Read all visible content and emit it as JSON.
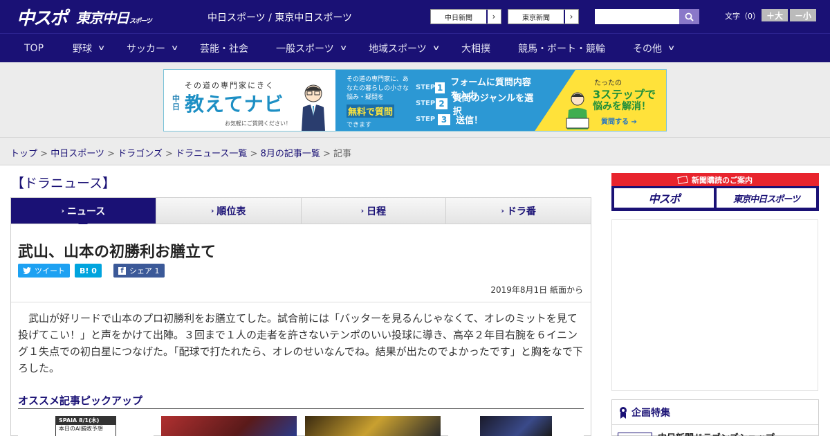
{
  "header": {
    "logo_chuspo": "中スポ",
    "logo_tokyo": "東京中日",
    "logo_tokyo_small": "スポーツ",
    "site_names": "中日スポーツ / 東京中日スポーツ",
    "link_chunichi": "中日新聞",
    "link_tokyo": "東京新聞",
    "font_label": "文字（0）",
    "font_bigger": "＋大",
    "font_smaller": "－小"
  },
  "nav": {
    "items": [
      {
        "label": "TOP"
      },
      {
        "label": "野球"
      },
      {
        "label": "サッカー"
      },
      {
        "label": "芸能・社会"
      },
      {
        "label": "一般スポーツ"
      },
      {
        "label": "地域スポーツ"
      },
      {
        "label": "大相撲"
      },
      {
        "label": "競馬・ボート・競輪"
      },
      {
        "label": "その他"
      }
    ]
  },
  "banner": {
    "tagline": "その道の専門家にきく",
    "brand_prefix": "中日",
    "brand": "教えてナビ",
    "note": "お気軽にご質問ください！",
    "question": "その道の専門家に、あなたの暮らしの小さな悩み・疑問を",
    "free": "無料で質問",
    "can": "できます",
    "step_word": "STEP",
    "steps": [
      "フォームに質問内容を入力",
      "質問のジャンルを選択",
      "送信！"
    ],
    "right_small": "たったの",
    "right_big": "3ステップで",
    "right_solve": "悩みを解消！",
    "right_cta": "質問する"
  },
  "breadcrumb": {
    "items": [
      "トップ",
      "中日スポーツ",
      "ドラゴンズ",
      "ドラニュース一覧",
      "8月の記事一覧"
    ],
    "current": "記事",
    "sep": " > "
  },
  "section_title": "【ドラニュース】",
  "tabs": [
    {
      "label": "ニュース"
    },
    {
      "label": "順位表"
    },
    {
      "label": "日程"
    },
    {
      "label": "ドラ番"
    }
  ],
  "article": {
    "headline": "武山、山本の初勝利お膳立て",
    "tweet": "ツイート",
    "hatena": "B! 0",
    "fb_share": "シェア 1",
    "date": "2019年8月1日 紙面から",
    "body": "武山が好リードで山本のプロ初勝利をお膳立てした。試合前には「バッターを見るんじゃなくて、オレのミットを見て投げてこい！」と声をかけて出陣。３回まで１人の走者を許さないテンポのいい投球に導き、高卒２年目右腕を６イニング１失点での初白星につなげた。「配球で打たれたら、オレのせいなんでね。結果が出たのでよかったです」と胸をなで下ろした。",
    "pickup_title": "オススメ記事ピックアップ",
    "thumb1_text": "SPAIA 8/1(木)",
    "thumb1_sub": "本日のAI勝敗予想"
  },
  "sidebar": {
    "subscribe_head": "新聞購読のご案内",
    "sub_chuspo": "中スポ",
    "sub_tokyo": "東京中日スポーツ",
    "feature_head": "企画特集",
    "feature_item": "中日新聞ドラゴンズショップ"
  },
  "colors": {
    "navy": "#1a1175",
    "red": "#e8242d",
    "twitter": "#1da1f2",
    "hatena": "#00a4de",
    "facebook": "#3b5998"
  }
}
